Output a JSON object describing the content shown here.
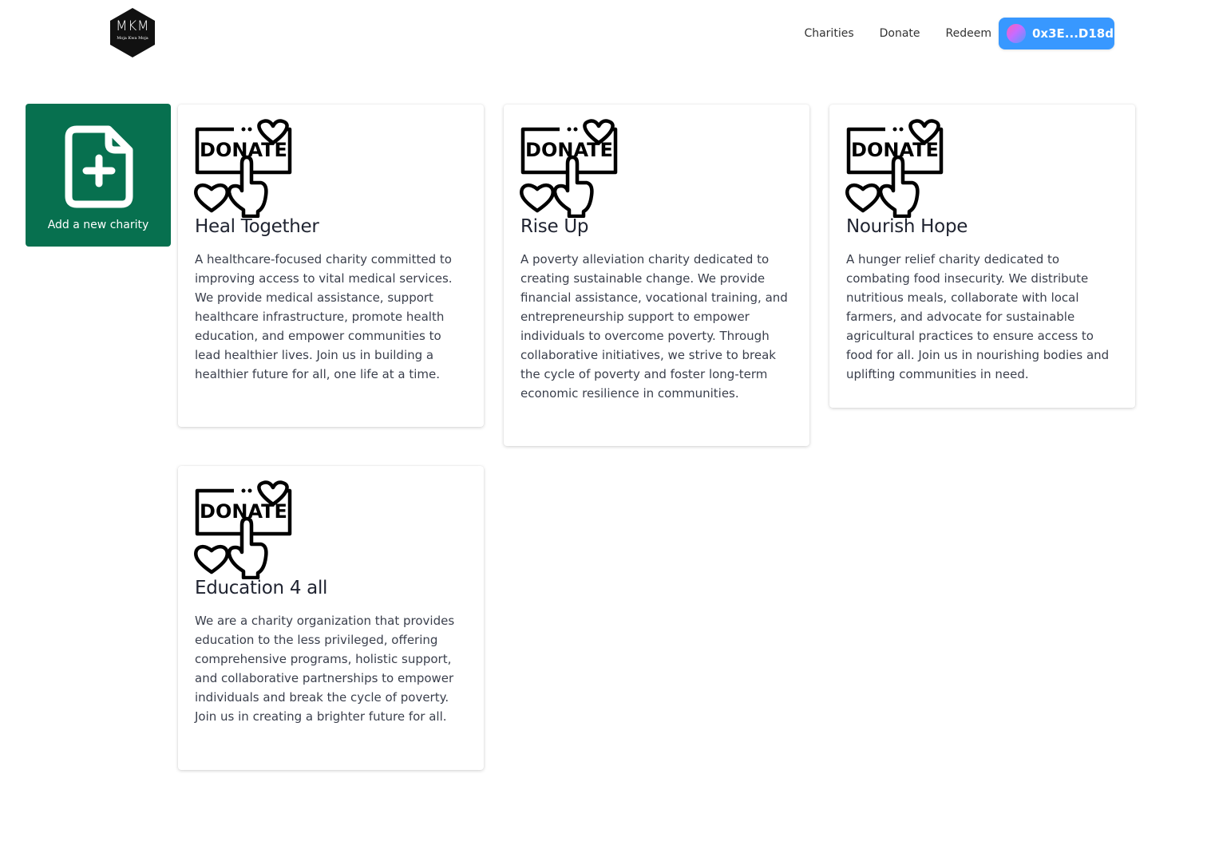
{
  "header": {
    "logo_text": "MKM",
    "logo_subtext": "Moja Kwa Moja",
    "nav": [
      "Charities",
      "Donate",
      "Redeem"
    ],
    "wallet_address": "0x3E...D18d"
  },
  "add_tile": {
    "label": "Add a new charity"
  },
  "charities": [
    {
      "image_text": "DONATE",
      "title": "Heal Together",
      "description": "A healthcare-focused charity committed to improving access to vital medical services. We provide medical assistance, support healthcare infrastructure, promote health education, and empower communities to lead healthier lives. Join us in building a healthier future for all, one life at a time."
    },
    {
      "image_text": "DONATE",
      "title": "Rise Up",
      "description": "A poverty alleviation charity dedicated to creating sustainable change. We provide financial assistance, vocational training, and entrepreneurship support to empower individuals to overcome poverty. Through collaborative initiatives, we strive to break the cycle of poverty and foster long-term economic resilience in communities."
    },
    {
      "image_text": "DONATE",
      "title": "Nourish Hope",
      "description": "A hunger relief charity dedicated to combating food insecurity. We distribute nutritious meals, collaborate with local farmers, and advocate for sustainable agricultural practices to ensure access to food for all. Join us in nourishing bodies and uplifting communities in need."
    },
    {
      "image_text": "DONATE",
      "title": "Education 4 all",
      "description": "We are a charity organization that provides education to the less privileged, offering comprehensive programs, holistic support, and collaborative partnerships to empower individuals and break the cycle of poverty. Join us in creating a brighter future for all."
    }
  ],
  "colors": {
    "primary_green": "#07704f",
    "wallet_blue": "#3898ff"
  }
}
